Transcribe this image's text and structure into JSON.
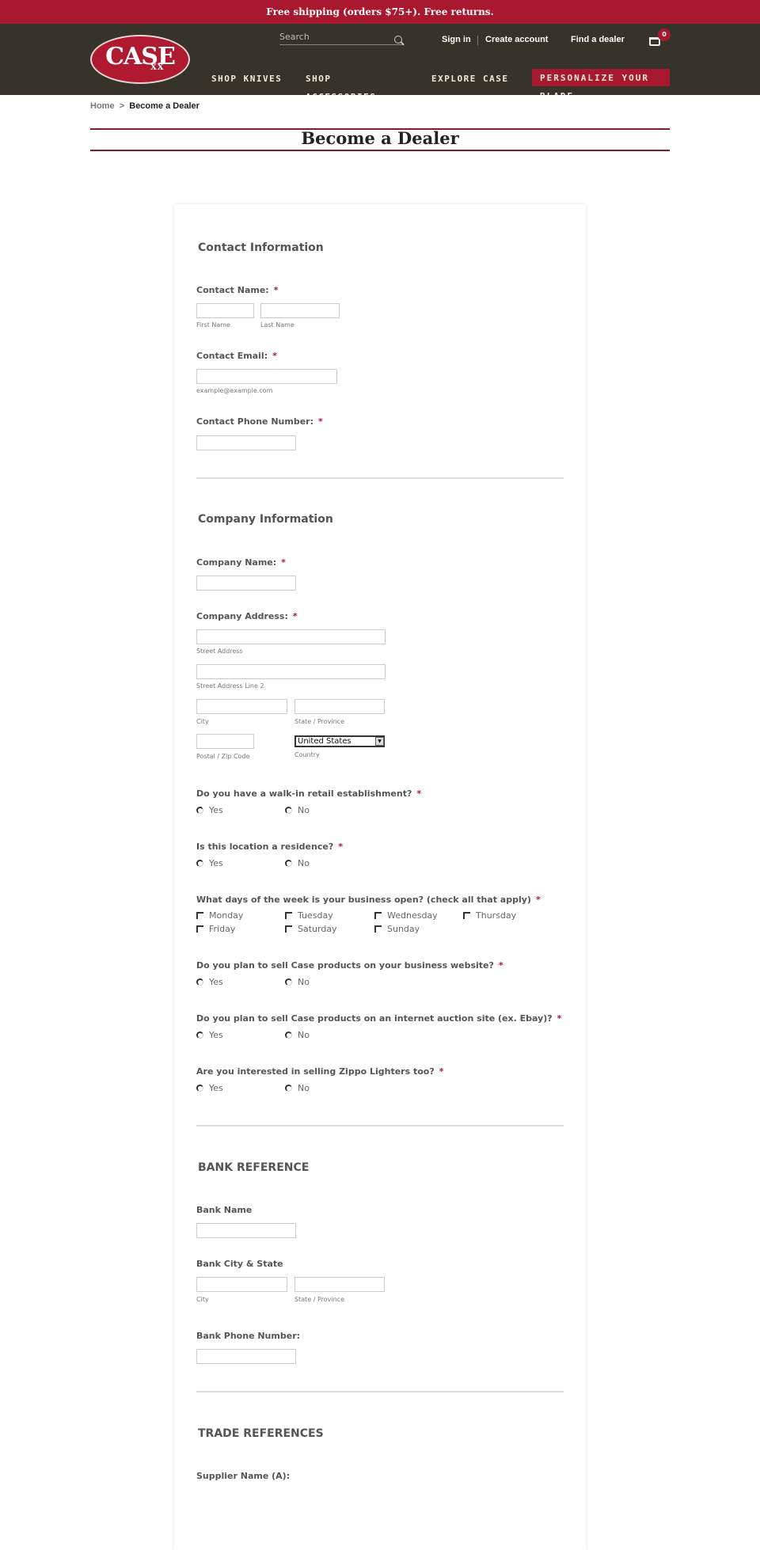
{
  "promo": "Free shipping (orders $75+). Free returns.",
  "header": {
    "logo": "CASE XX",
    "search_placeholder": "Search",
    "sign_in": "Sign in",
    "create_account": "Create account",
    "find_dealer": "Find a dealer",
    "cart_count": "0",
    "nav": [
      "SHOP KNIVES",
      "SHOP ACCESSORIES",
      "EXPLORE CASE",
      "PERSONALIZE YOUR BLADE"
    ]
  },
  "breadcrumb": {
    "home": "Home",
    "sep": ">",
    "current": "Become a Dealer"
  },
  "title": "Become a Dealer",
  "colors": {
    "brand": "#a8182f",
    "header_bg": "#36332b"
  },
  "form": {
    "contact_section": "Contact Information",
    "contact_name": "Contact Name:",
    "first_name": "First Name",
    "last_name": "Last Name",
    "contact_email": "Contact Email:",
    "email_hint": "example@example.com",
    "contact_phone": "Contact Phone Number:",
    "company_section": "Company Information",
    "company_name": "Company Name:",
    "company_address": "Company Address:",
    "street": "Street Address",
    "street2": "Street Address Line 2",
    "city": "City",
    "state": "State / Province",
    "zip": "Postal / Zip Code",
    "country_label": "Country",
    "country_value": "United States",
    "q_walkin": "Do you have a walk-in retail establishment?",
    "q_residence": "Is this location a residence?",
    "q_days": "What days of the week is your business open? (check all that apply)",
    "days": [
      "Monday",
      "Tuesday",
      "Wednesday",
      "Thursday",
      "Friday",
      "Saturday",
      "Sunday"
    ],
    "q_website": "Do you plan to sell Case products on your business website?",
    "q_auction": "Do you plan to sell Case products on an internet auction site (ex. Ebay)?",
    "q_zippo": "Are you interested in selling Zippo Lighters too?",
    "yes": "Yes",
    "no": "No",
    "required": "*",
    "bank_section": "BANK REFERENCE",
    "bank_name": "Bank Name",
    "bank_city_state": "Bank City & State",
    "bank_phone": "Bank Phone Number:",
    "trade_section": "TRADE REFERENCES",
    "supplier_a": "Supplier Name (A):"
  }
}
